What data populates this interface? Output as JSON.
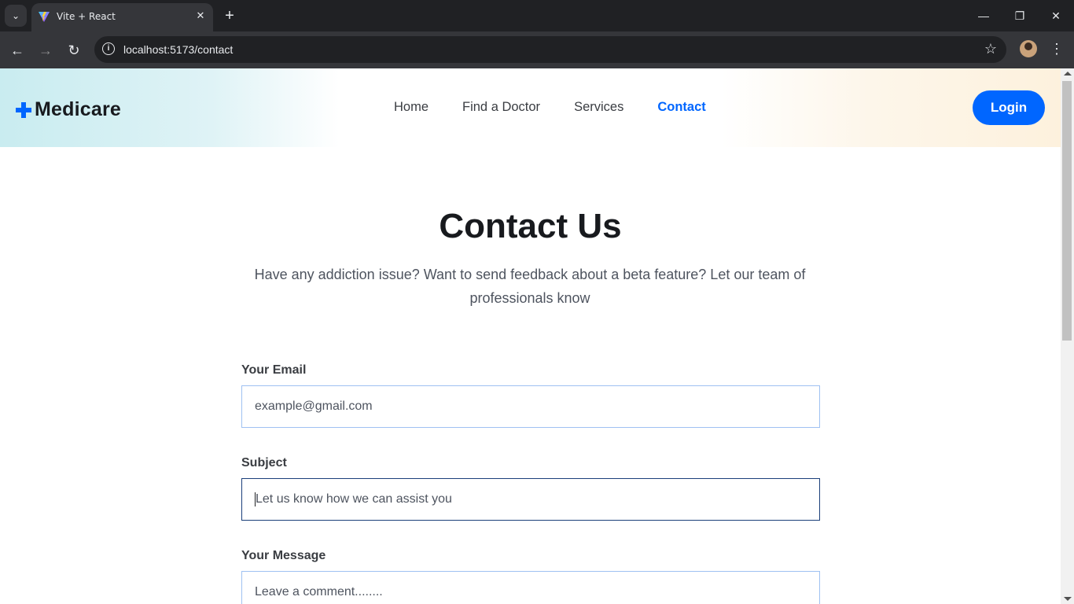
{
  "browser": {
    "tab_title": "Vite + React",
    "url": "localhost:5173/contact"
  },
  "header": {
    "logo_text": "Medicare",
    "nav": [
      {
        "label": "Home",
        "active": false
      },
      {
        "label": "Find a Doctor",
        "active": false
      },
      {
        "label": "Services",
        "active": false
      },
      {
        "label": "Contact",
        "active": true
      }
    ],
    "login_label": "Login"
  },
  "main": {
    "title": "Contact Us",
    "subtitle": "Have any addiction issue? Want to send feedback about a beta feature? Let our team of professionals know"
  },
  "form": {
    "email_label": "Your Email",
    "email_placeholder": "example@gmail.com",
    "subject_label": "Subject",
    "subject_placeholder": "Let us know how we can assist you",
    "message_label": "Your Message",
    "message_placeholder": "Leave a comment........"
  },
  "colors": {
    "brand": "#0066ff",
    "heading": "#181a1e",
    "text": "#4e545f"
  }
}
